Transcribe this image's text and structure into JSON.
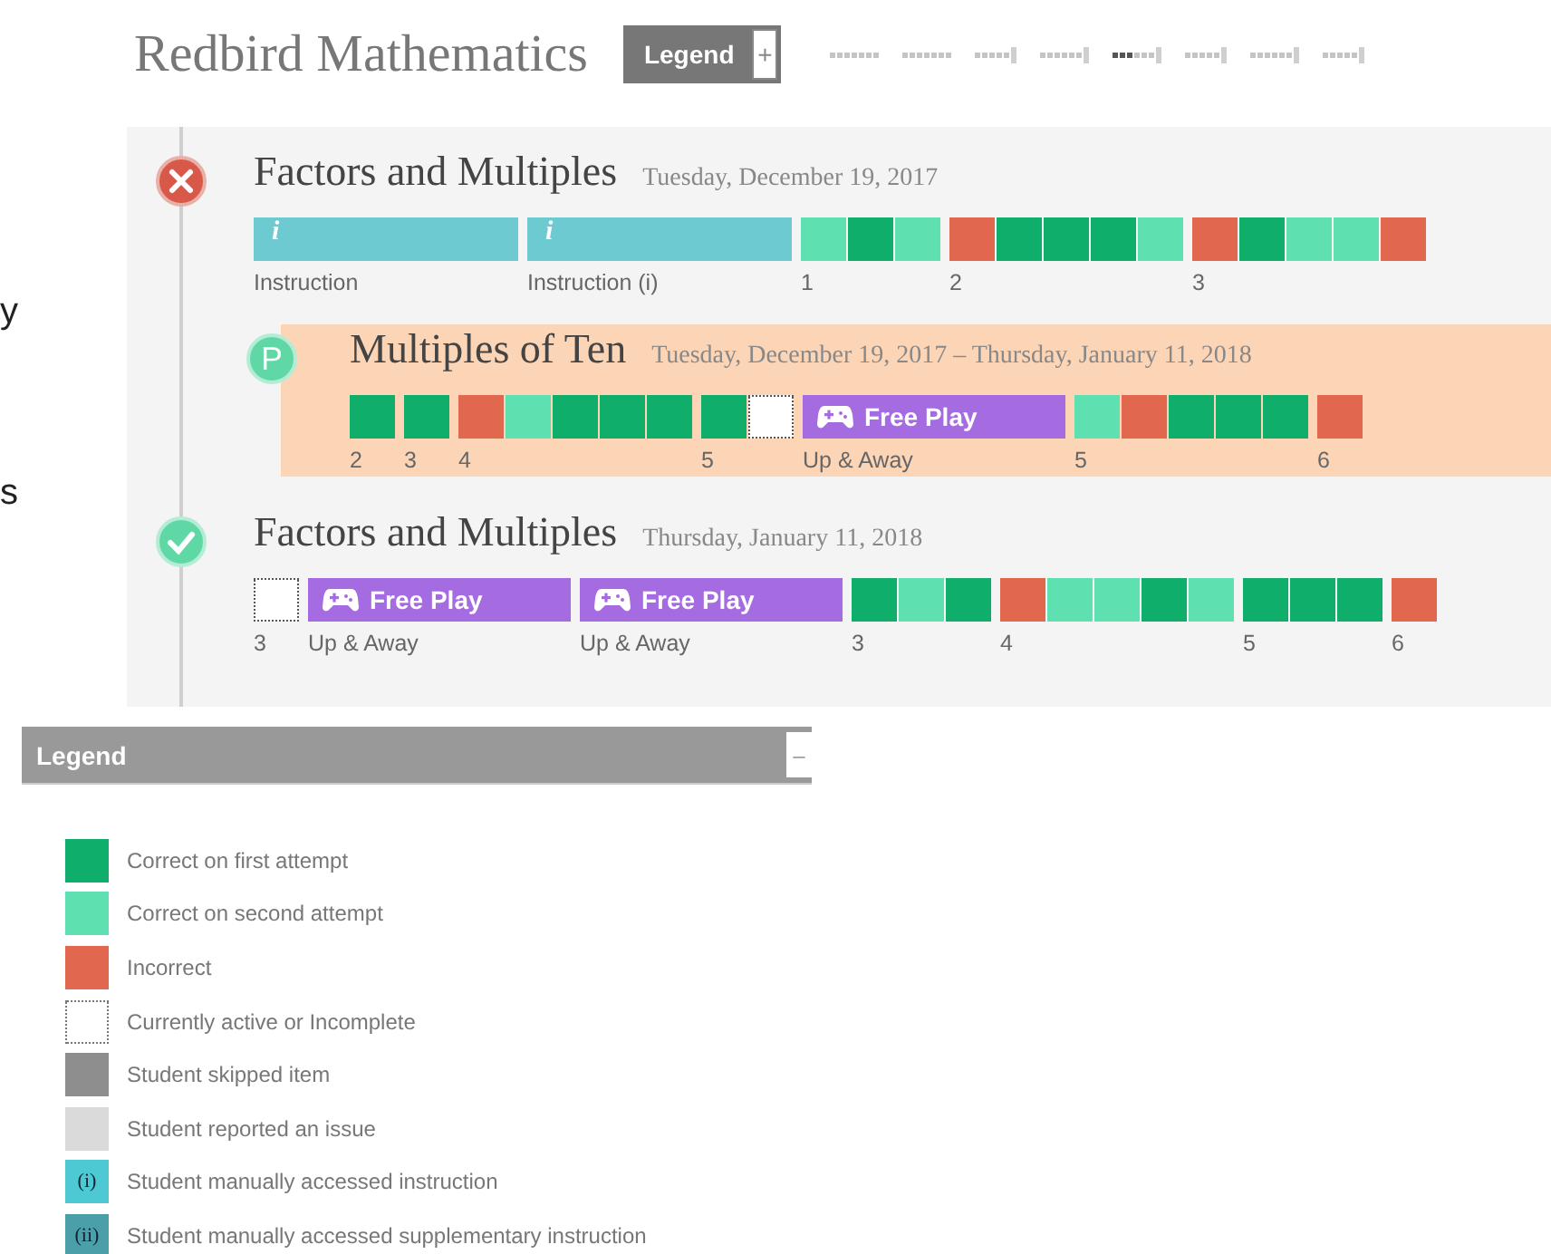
{
  "header": {
    "title": "Redbird Mathematics",
    "legend_button": {
      "label": "Legend",
      "toggle": "+"
    }
  },
  "margin_texts": [
    "y",
    "s"
  ],
  "lessons": [
    {
      "kind": "incorrect",
      "title": "Factors and Multiples",
      "date": "Tuesday, December 19, 2017",
      "selected": false,
      "segments": [
        {
          "kind": "instruction",
          "glyph": "i",
          "label": "Instruction"
        },
        {
          "kind": "instruction",
          "glyph": "i",
          "label": "Instruction (i)"
        },
        {
          "kind": "questions",
          "label": "1",
          "cells": [
            {
              "kind": "second"
            },
            {
              "kind": "first"
            },
            {
              "kind": "second"
            }
          ]
        },
        {
          "kind": "questions",
          "label": "2",
          "cells": [
            {
              "kind": "incorrect"
            },
            {
              "kind": "first"
            },
            {
              "kind": "first"
            },
            {
              "kind": "first"
            },
            {
              "kind": "second"
            }
          ]
        },
        {
          "kind": "questions",
          "label": "3",
          "cells": [
            {
              "kind": "incorrect"
            },
            {
              "kind": "first"
            },
            {
              "kind": "second"
            },
            {
              "kind": "second"
            },
            {
              "kind": "incorrect"
            }
          ]
        }
      ],
      "children": [
        {
          "kind": "progress",
          "badge": "P",
          "title": "Multiples of Ten",
          "date": "Tuesday, December 19, 2017 – Thursday, January 11, 2018",
          "selected": true,
          "segments": [
            {
              "kind": "questions",
              "label": "2",
              "cells": [
                {
                  "kind": "first"
                }
              ]
            },
            {
              "kind": "questions",
              "label": "3",
              "cells": [
                {
                  "kind": "first"
                }
              ]
            },
            {
              "kind": "questions",
              "label": "4",
              "cells": [
                {
                  "kind": "incorrect"
                },
                {
                  "kind": "second"
                },
                {
                  "kind": "first"
                },
                {
                  "kind": "first"
                },
                {
                  "kind": "first"
                }
              ]
            },
            {
              "kind": "questions",
              "label": "5",
              "cells": [
                {
                  "kind": "first"
                },
                {
                  "kind": "active"
                }
              ]
            },
            {
              "kind": "freeplay",
              "text": "Free Play",
              "label": "Up & Away"
            },
            {
              "kind": "questions",
              "label": "5",
              "cells": [
                {
                  "kind": "second"
                },
                {
                  "kind": "incorrect"
                },
                {
                  "kind": "first"
                },
                {
                  "kind": "first"
                },
                {
                  "kind": "first"
                }
              ]
            },
            {
              "kind": "questions",
              "label": "6",
              "cells": [
                {
                  "kind": "incorrect"
                }
              ]
            }
          ]
        }
      ]
    },
    {
      "kind": "complete",
      "title": "Factors and Multiples",
      "date": "Thursday, January 11, 2018",
      "selected": false,
      "segments": [
        {
          "kind": "questions",
          "label": "3",
          "cells": [
            {
              "kind": "active"
            }
          ]
        },
        {
          "kind": "freeplay",
          "text": "Free Play",
          "label": "Up & Away"
        },
        {
          "kind": "freeplay",
          "text": "Free Play",
          "label": "Up & Away"
        },
        {
          "kind": "questions",
          "label": "3",
          "cells": [
            {
              "kind": "first"
            },
            {
              "kind": "second"
            },
            {
              "kind": "first"
            }
          ]
        },
        {
          "kind": "questions",
          "label": "4",
          "cells": [
            {
              "kind": "incorrect"
            },
            {
              "kind": "second"
            },
            {
              "kind": "second"
            },
            {
              "kind": "first"
            },
            {
              "kind": "second"
            }
          ]
        },
        {
          "kind": "questions",
          "label": "5",
          "cells": [
            {
              "kind": "first"
            },
            {
              "kind": "first"
            },
            {
              "kind": "first"
            }
          ]
        },
        {
          "kind": "questions",
          "label": "6",
          "cells": [
            {
              "kind": "incorrect"
            }
          ]
        }
      ]
    }
  ],
  "legend": {
    "title": "Legend",
    "toggle": "–",
    "items": [
      {
        "kind": "first",
        "label": "Correct on first attempt"
      },
      {
        "kind": "second",
        "label": "Correct on second attempt"
      },
      {
        "kind": "incorrect",
        "label": "Incorrect"
      },
      {
        "kind": "active",
        "label": "Currently active or Incomplete"
      },
      {
        "kind": "skipped",
        "label": "Student skipped item"
      },
      {
        "kind": "issue",
        "label": "Student reported an issue"
      },
      {
        "kind": "instruction",
        "swatch_text": "(i)",
        "label": "Student manually accessed instruction"
      },
      {
        "kind": "supplementary",
        "swatch_text": "(ii)",
        "label": "Student manually accessed supplementary instruction"
      }
    ]
  }
}
